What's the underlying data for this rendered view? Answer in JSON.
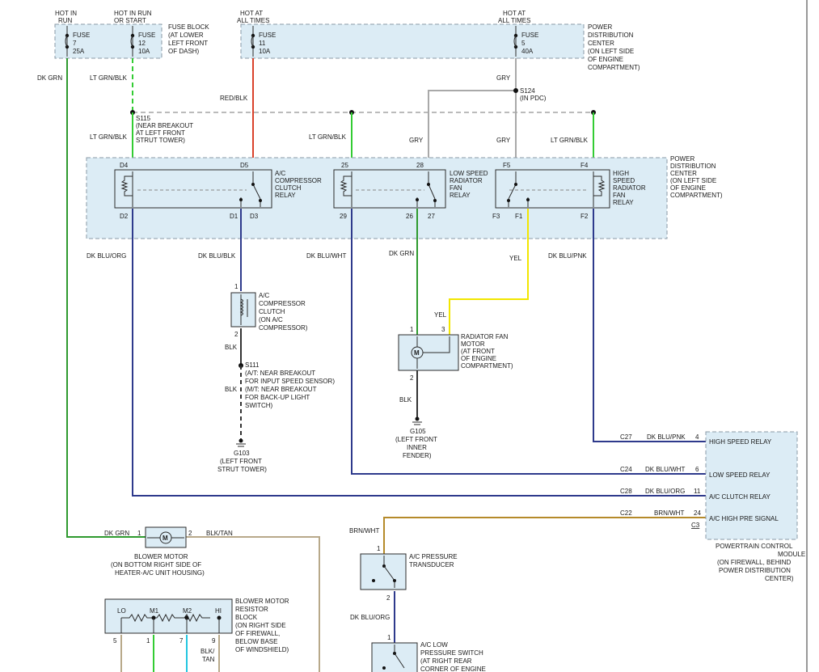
{
  "colors": {
    "dk_grn": "#2e9a2e",
    "lt_grn": "#33cc33",
    "red": "#d9412b",
    "gray": "#a9a9a9",
    "dk_blu": "#2e3a8c",
    "yel": "#f2e600",
    "blk": "#333333",
    "brn_wht": "#b58a2a",
    "cyan": "#22c6e0",
    "tan": "#b8a98a",
    "box_fill": "#dcecf5"
  },
  "header": {
    "hot_in_run": [
      "HOT IN",
      "RUN"
    ],
    "hot_in_run_start": [
      "HOT IN RUN",
      "OR START"
    ],
    "hot_at_all_times_1": [
      "HOT AT",
      "ALL TIMES"
    ],
    "hot_at_all_times_2": [
      "HOT AT",
      "ALL TIMES"
    ]
  },
  "fuses": {
    "f7": [
      "FUSE",
      "7",
      "25A"
    ],
    "f12": [
      "FUSE",
      "12",
      "10A"
    ],
    "f11": [
      "FUSE",
      "11",
      "10A"
    ],
    "f5": [
      "FUSE",
      "5",
      "40A"
    ],
    "fuse_block_label": [
      "FUSE BLOCK",
      "(AT LOWER",
      "LEFT FRONT",
      "OF DASH)"
    ],
    "pdc_label_top": [
      "POWER",
      "DISTRIBUTION",
      "CENTER",
      "(ON LEFT SIDE",
      "OF ENGINE",
      "COMPARTMENT)"
    ]
  },
  "wire_labels": {
    "dk_grn": "DK GRN",
    "lt_grn_blk_1": "LT GRN/BLK",
    "red_blk": "RED/BLK",
    "gry_1": "GRY",
    "s124": [
      "S124",
      "(IN PDC)"
    ],
    "s115": [
      "S115",
      "(NEAR BREAKOUT",
      "AT LEFT FRONT",
      "STRUT TOWER)"
    ],
    "lt_grn_blk_2": "LT GRN/BLK",
    "lt_grn_blk_3": "LT GRN/BLK",
    "gry_2": "GRY",
    "gry_3": "GRY",
    "lt_grn_blk_4": "LT GRN/BLK",
    "dk_blu_org_1": "DK BLU/ORG",
    "dk_blu_blk": "DK BLU/BLK",
    "dk_blu_wht_1": "DK BLU/WHT",
    "dk_grn_2": "DK GRN",
    "yel_1": "YEL",
    "dk_blu_pnk_1": "DK BLU/PNK",
    "yel_2": "YEL",
    "blk_1": "BLK",
    "blk_2": "BLK",
    "blk_3": "BLK",
    "brn_wht_1": "BRN/WHT",
    "dk_blu_org_2": "DK BLU/ORG",
    "dk_grn_3": "DK GRN",
    "blk_tan_1": "BLK/TAN",
    "blk_tan_2": [
      "BLK/",
      "TAN"
    ]
  },
  "pdc_relays": {
    "pdc_label": [
      "POWER",
      "DISTRIBUTION",
      "CENTER",
      "(ON LEFT SIDE",
      "OF ENGINE",
      "COMPARTMENT)"
    ],
    "ac_relay": {
      "label": [
        "A/C",
        "COMPRESSOR",
        "CLUTCH",
        "RELAY"
      ],
      "pins": [
        "D4",
        "D5",
        "D2",
        "D1",
        "D3"
      ]
    },
    "low_relay": {
      "label": [
        "LOW SPEED",
        "RADIATOR",
        "FAN",
        "RELAY"
      ],
      "pins": [
        "25",
        "28",
        "29",
        "26",
        "27"
      ]
    },
    "high_relay": {
      "label": [
        "HIGH",
        "SPEED",
        "RADIATOR",
        "FAN",
        "RELAY"
      ],
      "pins": [
        "F5",
        "F4",
        "F3",
        "F1",
        "F2"
      ]
    }
  },
  "components": {
    "ac_clutch": {
      "label": [
        "A/C",
        "COMPRESSOR",
        "CLUTCH",
        "(ON A/C",
        "COMPRESSOR)"
      ],
      "pin_top": "1",
      "pin_bot": "2"
    },
    "s111": [
      "S111",
      "(A/T: NEAR BREAKOUT",
      "FOR INPUT SPEED SENSOR)",
      "(M/T: NEAR BREAKOUT",
      "FOR BACK-UP LIGHT",
      "SWITCH)"
    ],
    "g103": [
      "G103",
      "(LEFT FRONT",
      "STRUT TOWER)"
    ],
    "fan_motor": {
      "label": [
        "RADIATOR FAN",
        "MOTOR",
        "(AT FRONT",
        "OF ENGINE",
        "COMPARTMENT)"
      ],
      "pin1": "1",
      "pin3": "3",
      "pin2": "2"
    },
    "g105": [
      "G105",
      "(LEFT FRONT",
      "INNER",
      "FENDER)"
    ],
    "blower_motor": {
      "label": [
        "BLOWER MOTOR",
        "(ON BOTTOM RIGHT SIDE OF",
        "HEATER-A/C UNIT HOUSING)"
      ],
      "pin1": "1",
      "pin2": "2"
    },
    "resistor": {
      "label": [
        "BLOWER MOTOR",
        "RESISTOR",
        "BLOCK",
        "(ON RIGHT SIDE",
        "OF FIREWALL,",
        "BELOW BASE",
        "OF WINDSHIELD)"
      ],
      "taps": [
        "LO",
        "M1",
        "M2",
        "HI"
      ],
      "pins": [
        "5",
        "1",
        "7",
        "9"
      ]
    },
    "transducer": {
      "label": [
        "A/C PRESSURE",
        "TRANSDUCER"
      ],
      "pin1": "1",
      "pin2": "2"
    },
    "low_switch": {
      "label": [
        "A/C LOW",
        "PRESSURE SWITCH",
        "(AT RIGHT REAR",
        "CORNER OF ENGINE"
      ],
      "pin1": "1"
    }
  },
  "pcm": {
    "label": [
      "POWERTRAIN CONTROL",
      "MODULE",
      "(ON FIREWALL, BEHIND",
      "POWER DISTRIBUTION",
      "CENTER)"
    ],
    "connector": "C3",
    "pins": [
      {
        "cav": "C27",
        "wire": "DK BLU/PNK",
        "pin": "4",
        "name": "HIGH SPEED RELAY"
      },
      {
        "cav": "C24",
        "wire": "DK BLU/WHT",
        "pin": "6",
        "name": "LOW SPEED RELAY"
      },
      {
        "cav": "C28",
        "wire": "DK BLU/ORG",
        "pin": "11",
        "name": "A/C CLUTCH RELAY"
      },
      {
        "cav": "C22",
        "wire": "BRN/WHT",
        "pin": "24",
        "name": "A/C HIGH PRE SIGNAL"
      }
    ]
  }
}
